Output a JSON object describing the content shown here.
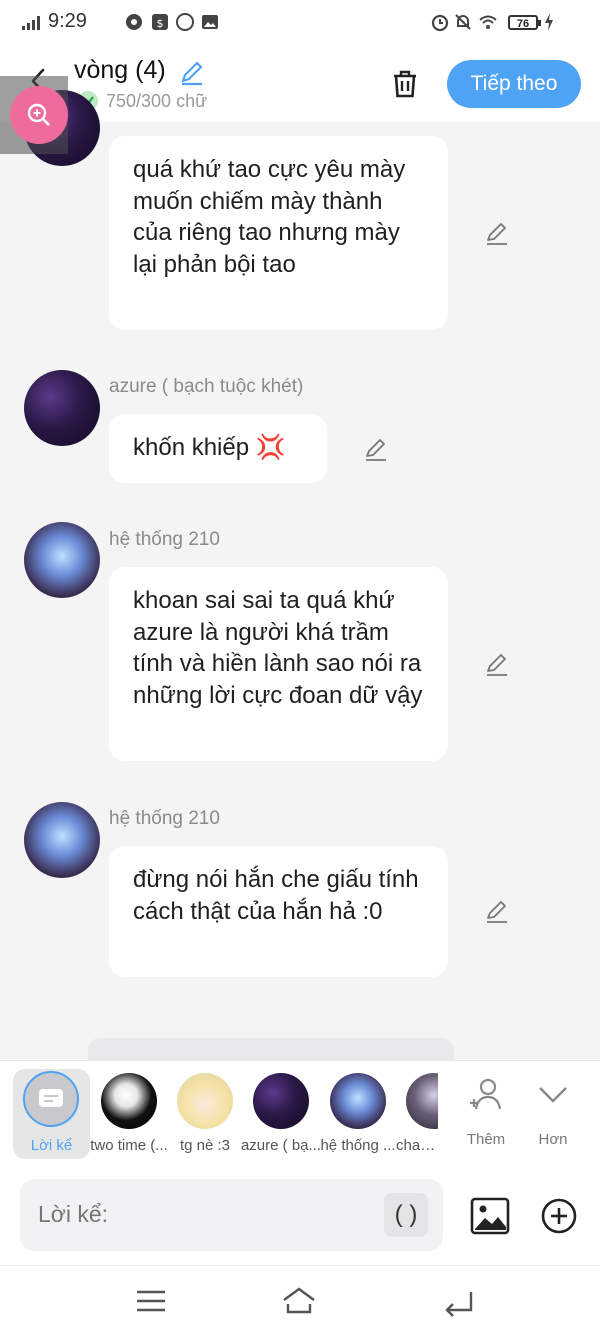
{
  "status_bar": {
    "time": "9:29",
    "battery": "76"
  },
  "header": {
    "title": "vòng (4)",
    "char_count": "750/300 chữ",
    "next_label": "Tiếp theo"
  },
  "messages": [
    {
      "sender": "",
      "text": "quá khứ tao cực yêu mày muốn chiếm mày thành của riêng tao nhưng mày lại phản bội tao"
    },
    {
      "sender": "azure ( bạch tuộc khét)",
      "text": "khốn khiếp 💢"
    },
    {
      "sender": "hệ thống 210",
      "text": "khoan sai sai ta quá khứ azure là người khá trầm tính và hiền lành sao nói ra những lời cực đoan dữ vậy"
    },
    {
      "sender": "hệ thống 210",
      "text": "đừng nói hắn che giấu tính cách thật của hắn hả :0"
    }
  ],
  "characters": {
    "selected_label": "Lời kể",
    "items": [
      {
        "name": "two time (..."
      },
      {
        "name": "tg nè :3"
      },
      {
        "name": "azure ( bạ..."
      },
      {
        "name": "hệ thống ..."
      },
      {
        "name": "chanc..."
      }
    ],
    "add_label": "Thêm",
    "more_label": "Hơn"
  },
  "composer": {
    "placeholder": "Lời kể:",
    "paren_label": "( )"
  },
  "colors": {
    "accent": "#4fa3f5",
    "zoom": "#ee6c9d",
    "background": "#f4f4f5"
  }
}
